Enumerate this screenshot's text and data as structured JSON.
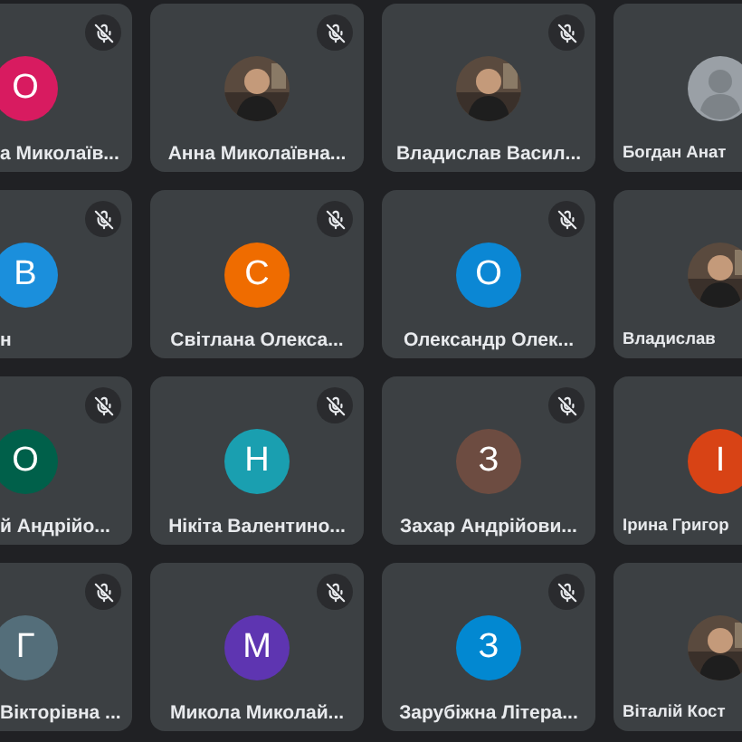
{
  "tiles": [
    {
      "name": "а Миколаїв...",
      "kind": "cut_left",
      "muted": true,
      "avatar": {
        "kind": "letter",
        "letter": "О",
        "color": "#d81b60"
      }
    },
    {
      "name": "Анна Миколаївна...",
      "kind": "whole",
      "muted": true
    },
    {
      "name": "Владислав Васил...",
      "kind": "whole",
      "muted": true
    },
    {
      "name": "Богдан Анат",
      "kind": "cut_right",
      "avatar": {
        "kind": "default"
      }
    },
    {
      "name": "н",
      "kind": "cut_left",
      "muted": true,
      "avatar": {
        "kind": "letter",
        "letter": "В",
        "color": "#1b8fdc"
      }
    },
    {
      "name": "Світлана Олекса...",
      "kind": "whole",
      "muted": true,
      "avatar": {
        "kind": "letter",
        "letter": "С",
        "color": "#ef6c00"
      }
    },
    {
      "name": "Олександр Олек...",
      "kind": "whole",
      "muted": true,
      "avatar": {
        "kind": "letter",
        "letter": "О",
        "color": "#0b87d4"
      }
    },
    {
      "name": "Владислав",
      "kind": "cut_right"
    },
    {
      "name": "й Андрійо...",
      "kind": "cut_left",
      "muted": true,
      "avatar": {
        "kind": "letter",
        "letter": "О",
        "color": "#00604a"
      }
    },
    {
      "name": "Нікіта Валентино...",
      "kind": "whole",
      "muted": true,
      "avatar": {
        "kind": "letter",
        "letter": "Н",
        "color": "#1a9fb0"
      }
    },
    {
      "name": "Захар Андрійови...",
      "kind": "whole",
      "muted": true,
      "avatar": {
        "kind": "letter",
        "letter": "З",
        "color": "#6d4c41"
      }
    },
    {
      "name": "Ірина Григор",
      "kind": "cut_right",
      "avatar": {
        "kind": "letter",
        "letter": "І",
        "color": "#d84315"
      }
    },
    {
      "name": "Вікторівна ...",
      "kind": "cut_left",
      "muted": true,
      "avatar": {
        "kind": "letter",
        "letter": "Г",
        "color": "#546e7a"
      }
    },
    {
      "name": "Микола Миколай...",
      "kind": "whole",
      "muted": true,
      "avatar": {
        "kind": "letter",
        "letter": "М",
        "color": "#5e35b1"
      }
    },
    {
      "name": "Зарубіжна Літера...",
      "kind": "whole",
      "muted": true,
      "avatar": {
        "kind": "letter",
        "letter": "З",
        "color": "#0288d1"
      }
    },
    {
      "name": "Віталій Кост",
      "kind": "cut_right"
    }
  ]
}
